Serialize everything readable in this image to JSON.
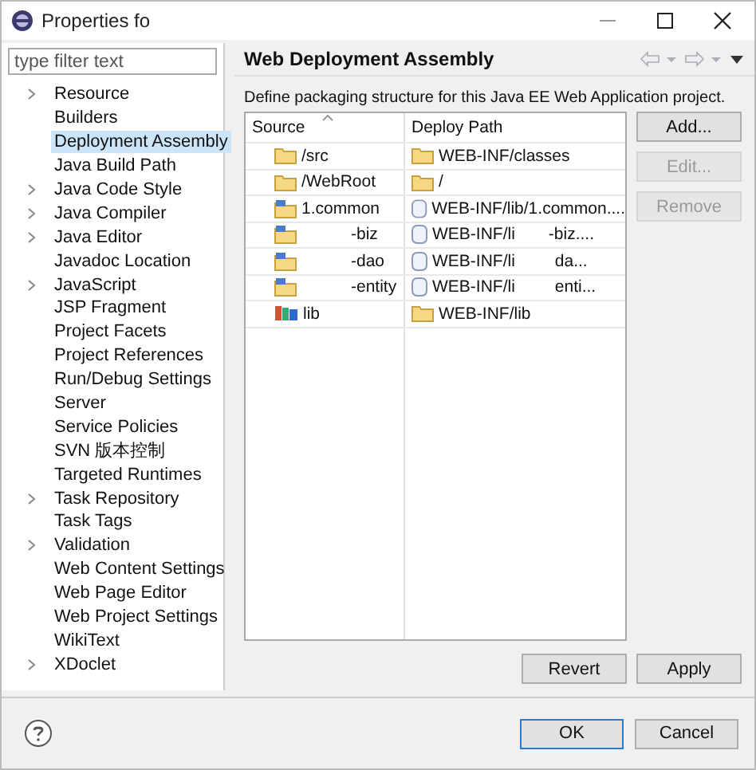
{
  "window": {
    "title": "Properties fo"
  },
  "filter": {
    "placeholder": "type filter text"
  },
  "tree": [
    {
      "label": "Resource",
      "expandable": true,
      "selected": false
    },
    {
      "label": "Builders",
      "expandable": false,
      "selected": false
    },
    {
      "label": "Deployment Assembly",
      "expandable": false,
      "selected": true
    },
    {
      "label": "Java Build Path",
      "expandable": false,
      "selected": false
    },
    {
      "label": "Java Code Style",
      "expandable": true,
      "selected": false
    },
    {
      "label": "Java Compiler",
      "expandable": true,
      "selected": false
    },
    {
      "label": "Java Editor",
      "expandable": true,
      "selected": false
    },
    {
      "label": "Javadoc Location",
      "expandable": false,
      "selected": false
    },
    {
      "label": "JavaScript",
      "expandable": true,
      "selected": false
    },
    {
      "label": "JSP Fragment",
      "expandable": false,
      "selected": false
    },
    {
      "label": "Project Facets",
      "expandable": false,
      "selected": false
    },
    {
      "label": "Project References",
      "expandable": false,
      "selected": false
    },
    {
      "label": "Run/Debug Settings",
      "expandable": false,
      "selected": false
    },
    {
      "label": "Server",
      "expandable": false,
      "selected": false
    },
    {
      "label": "Service Policies",
      "expandable": false,
      "selected": false
    },
    {
      "label": "SVN 版本控制",
      "expandable": false,
      "selected": false
    },
    {
      "label": "Targeted Runtimes",
      "expandable": false,
      "selected": false
    },
    {
      "label": "Task Repository",
      "expandable": true,
      "selected": false
    },
    {
      "label": "Task Tags",
      "expandable": false,
      "selected": false
    },
    {
      "label": "Validation",
      "expandable": true,
      "selected": false
    },
    {
      "label": "Web Content Settings",
      "expandable": false,
      "selected": false
    },
    {
      "label": "Web Page Editor",
      "expandable": false,
      "selected": false
    },
    {
      "label": "Web Project Settings",
      "expandable": false,
      "selected": false
    },
    {
      "label": "WikiText",
      "expandable": false,
      "selected": false
    },
    {
      "label": "XDoclet",
      "expandable": true,
      "selected": false
    }
  ],
  "page": {
    "title": "Web Deployment Assembly",
    "description": "Define packaging structure for this Java EE Web Application project."
  },
  "table": {
    "columns": [
      "Source",
      "Deploy Path"
    ],
    "rows": [
      {
        "source": {
          "kind": "folder",
          "text": "/src"
        },
        "path": {
          "kind": "folder",
          "text": "WEB-INF/classes"
        }
      },
      {
        "source": {
          "kind": "folder",
          "text": "/WebRoot"
        },
        "path": {
          "kind": "folder",
          "text": "/"
        }
      },
      {
        "source": {
          "kind": "project",
          "text": "1.common"
        },
        "path": {
          "kind": "jar",
          "text": "WEB-INF/lib/1.common...."
        }
      },
      {
        "source": {
          "kind": "project",
          "text": "-biz"
        },
        "path": {
          "kind": "jar",
          "text": "WEB-INF/li",
          "tail": "-biz...."
        }
      },
      {
        "source": {
          "kind": "project",
          "text": "-dao"
        },
        "path": {
          "kind": "jar",
          "text": "WEB-INF/li",
          "tail": "da..."
        }
      },
      {
        "source": {
          "kind": "project",
          "text": "-entity"
        },
        "path": {
          "kind": "jar",
          "text": "WEB-INF/li",
          "tail": "enti..."
        }
      },
      {
        "source": {
          "kind": "library",
          "text": "lib"
        },
        "path": {
          "kind": "folder",
          "text": "WEB-INF/lib"
        }
      }
    ]
  },
  "side_buttons": [
    {
      "label": "Add...",
      "disabled": false
    },
    {
      "label": "Edit...",
      "disabled": true
    },
    {
      "label": "Remove",
      "disabled": true
    }
  ],
  "page_buttons": [
    "Revert",
    "Apply"
  ],
  "dialog_buttons": [
    {
      "label": "OK",
      "default": true
    },
    {
      "label": "Cancel",
      "default": false
    }
  ]
}
